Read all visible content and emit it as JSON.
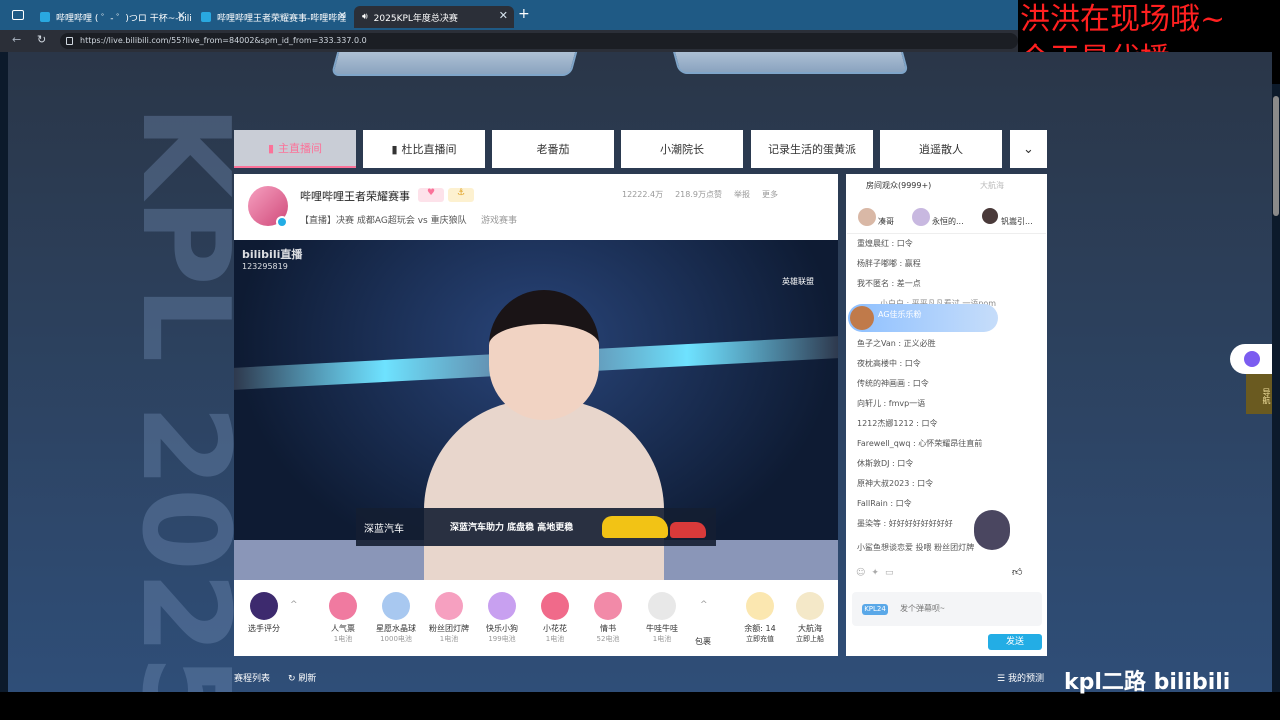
{
  "browser": {
    "tabs": [
      {
        "label": "哔哩哔哩 ( ゜- ゜)つロ 干杯~-bilibili"
      },
      {
        "label": "哔哩哔哩王者荣耀赛事-哔哩哔哩"
      },
      {
        "label": "2025KPL年度总决赛"
      }
    ],
    "new_tab": "+",
    "url": "https://live.bilibili.com/55?live_from=84002&spm_id_from=333.337.0.0"
  },
  "overlay": {
    "line1": "洪洪在现场哦~",
    "line2": "今天是代播~"
  },
  "streamer_tabs": [
    "主直播间",
    "杜比直播间",
    "老番茄",
    "小潮院长",
    "记录生活的蛋黄派",
    "逍遥散人"
  ],
  "room": {
    "name": "哔哩哔哩王者荣耀赛事",
    "title": "【直播】决赛 成都AG超玩会 vs 重庆狼队",
    "category": "游戏赛事",
    "stats": [
      "12222.4万",
      "218.9万点赞",
      "举报",
      "更多"
    ]
  },
  "video": {
    "logo": "bilibili直播",
    "room_id": "123295819",
    "corner": "英雄联盟",
    "ad_brand": "深蓝汽车",
    "ad_slogan": "深蓝汽车助力 底盘稳 高地更稳"
  },
  "gifts": [
    {
      "name": "选手评分",
      "sub": ""
    },
    {
      "name": "人气票",
      "sub": "1电池"
    },
    {
      "name": "星愿水晶球",
      "sub": "1000电池"
    },
    {
      "name": "粉丝团灯牌",
      "sub": "1电池"
    },
    {
      "name": "快乐小狗",
      "sub": "199电池"
    },
    {
      "name": "小花花",
      "sub": "1电池"
    },
    {
      "name": "情书",
      "sub": "52电池"
    },
    {
      "name": "牛哇牛哇",
      "sub": "1电池"
    },
    {
      "name": "包裹",
      "sub": ""
    },
    {
      "name": "余额: 14",
      "sub": "立即充值"
    },
    {
      "name": "大航海",
      "sub": "立即上船"
    }
  ],
  "chat": {
    "tab_audience": "房间观众(9999+)",
    "tab_rank": "大航海",
    "top_users": [
      "凑哥",
      "永恒的...",
      "钒嵩引..."
    ],
    "messages": [
      "重煌晨红 : 口令",
      "杨胖子嘟嘟 : 赢程",
      "我不匿名 : 差一点",
      "小白白 : 平平凡凡看过 一语pom",
      "AG佳乐乐粉",
      "鱼子之Van : 正义必胜",
      "夜枕高楼中 : 口令",
      "传统的神画画 : 口令",
      "向轩儿 : fmvp一语",
      "1212杰娜1212 : 口令",
      "Farewell_qwq : 心怀荣耀昂往直前",
      "休斯敦DJ : 口令",
      "原神大叔2023 : 口令",
      "FallRain : 口令",
      "墨染等 : 好好好好好好好好",
      "小鲨鱼想谈恋爱 投喂 粉丝团灯牌"
    ],
    "input_placeholder": "发个弹幕呗~",
    "medal": "KPL24",
    "send_label": "发送"
  },
  "footer": {
    "left": "赛程列表",
    "refresh": "刷新",
    "right": "我的预测"
  },
  "side": {
    "nav": "导航"
  },
  "watermark": "kpl二路 bilibili",
  "colors": {
    "accent": "#fb7299",
    "blue": "#23ade5"
  }
}
